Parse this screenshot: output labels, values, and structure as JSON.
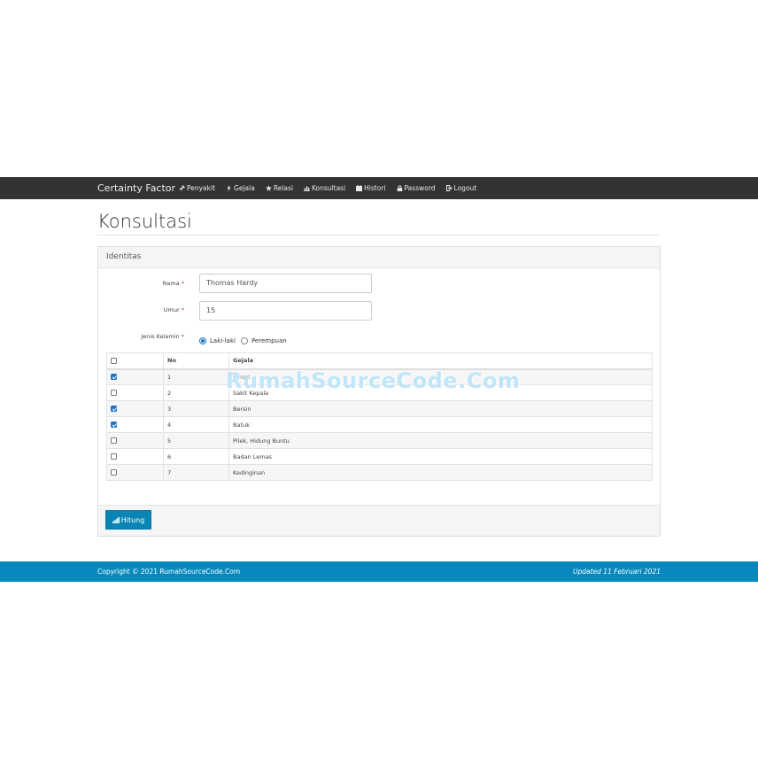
{
  "navbar": {
    "brand": "Certainty Factor",
    "items": [
      {
        "label": "Penyakit",
        "icon": "pushpin-icon"
      },
      {
        "label": "Gejala",
        "icon": "flash-icon"
      },
      {
        "label": "Relasi",
        "icon": "star-icon"
      },
      {
        "label": "Konsultasi",
        "icon": "stats-icon"
      },
      {
        "label": "Histori",
        "icon": "calendar-icon"
      },
      {
        "label": "Password",
        "icon": "lock-icon"
      },
      {
        "label": "Logout",
        "icon": "logout-icon"
      }
    ]
  },
  "page": {
    "title": "Konsultasi"
  },
  "panel": {
    "heading": "Identitas",
    "form": {
      "nama_label": "Nama",
      "nama_value": "Thomas Hardy",
      "umur_label": "Umur",
      "umur_value": "15",
      "jenis_kelamin_label": "Jenis Kelamin",
      "required_mark": "*",
      "gender_options": [
        {
          "label": "Laki-laki",
          "selected": true
        },
        {
          "label": "Perempuan",
          "selected": false
        }
      ]
    },
    "table": {
      "headers": {
        "no": "No",
        "gejala": "Gejala"
      },
      "rows": [
        {
          "no": "1",
          "gejala": "Panas",
          "checked": true
        },
        {
          "no": "2",
          "gejala": "Sakit Kepala",
          "checked": false
        },
        {
          "no": "3",
          "gejala": "Bersin",
          "checked": true
        },
        {
          "no": "4",
          "gejala": "Batuk",
          "checked": true
        },
        {
          "no": "5",
          "gejala": "Pilek, Hidung Buntu",
          "checked": false
        },
        {
          "no": "6",
          "gejala": "Badan Lemas",
          "checked": false
        },
        {
          "no": "7",
          "gejala": "Kedinginan",
          "checked": false
        }
      ]
    },
    "button_label": "Hitung"
  },
  "footer": {
    "copyright": "Copyright © 2021 RumahSourceCode.Com",
    "updated": "Updated 11 Februari 2021"
  },
  "watermark": "RumahSourceCode.Com",
  "colors": {
    "navbar": "#333333",
    "footer": "#0889bd",
    "button": "#0a85b5",
    "accent": "#1a73c8"
  }
}
